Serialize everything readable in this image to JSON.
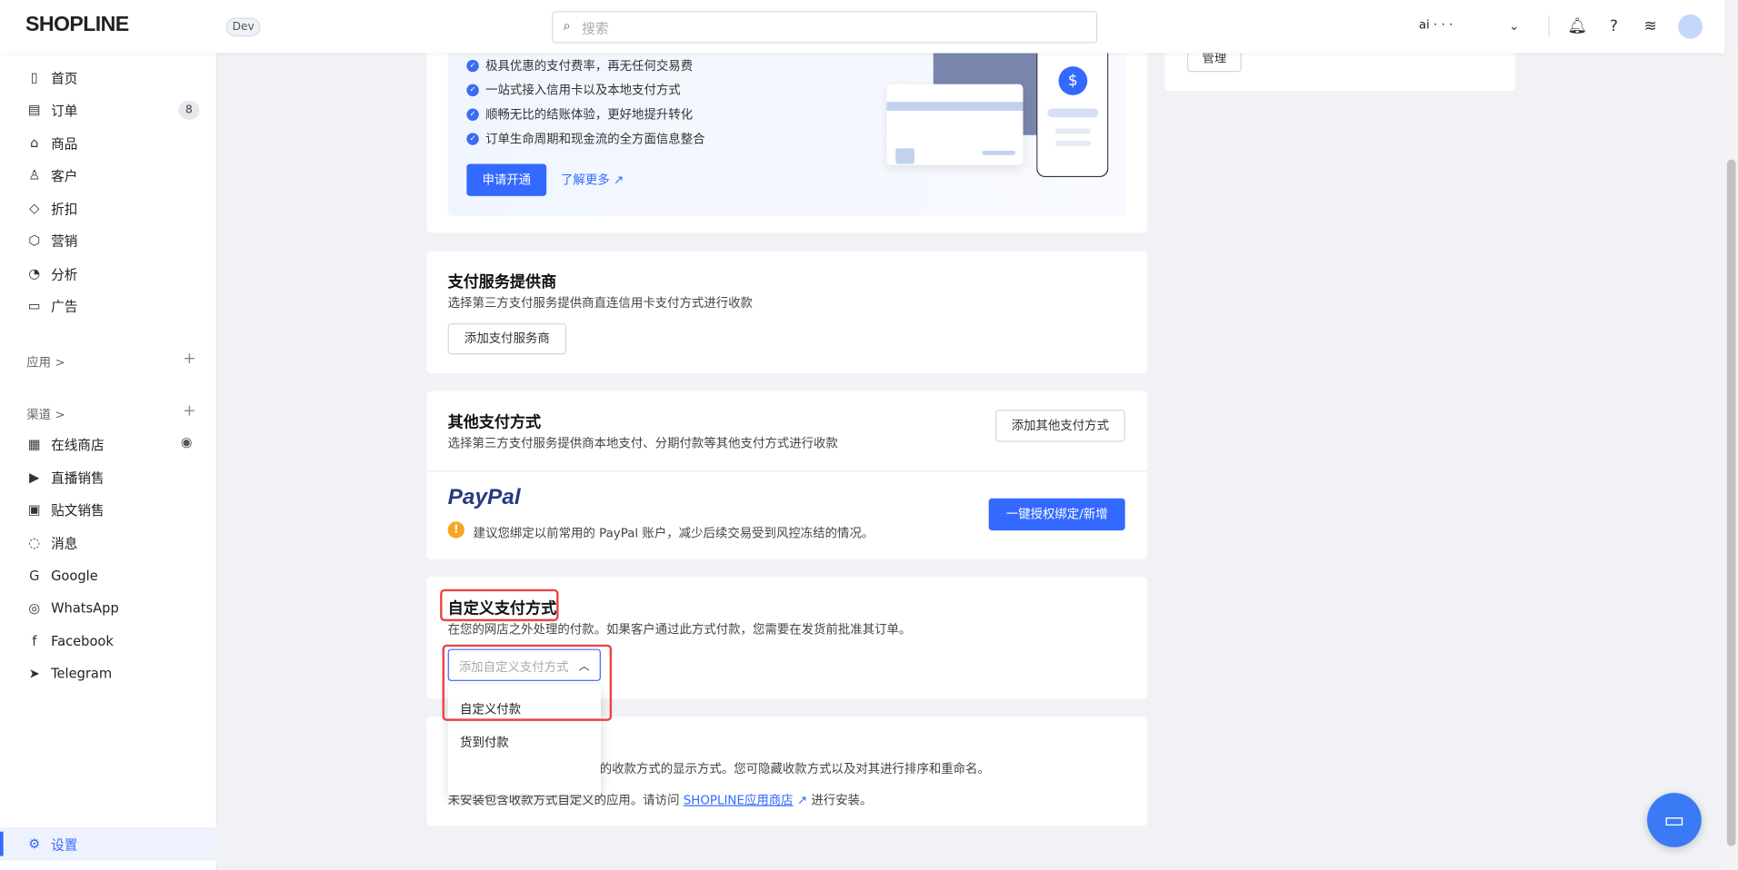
{
  "header": {
    "logo": "SHOPLINE",
    "env_badge": "Dev",
    "search_placeholder": "搜索",
    "account": "ai · · ·"
  },
  "sidebar": {
    "items": [
      {
        "label": "首页",
        "icon": "dashboard-icon"
      },
      {
        "label": "订单",
        "icon": "order-icon",
        "badge": "8"
      },
      {
        "label": "商品",
        "icon": "bag-icon"
      },
      {
        "label": "客户",
        "icon": "user-icon"
      },
      {
        "label": "折扣",
        "icon": "tag-icon"
      },
      {
        "label": "营销",
        "icon": "box-icon"
      },
      {
        "label": "分析",
        "icon": "pie-icon"
      },
      {
        "label": "广告",
        "icon": "ad-icon"
      }
    ],
    "apps_label": "应用 >",
    "channels_label": "渠道 >",
    "channels": [
      {
        "label": "在线商店"
      },
      {
        "label": "直播销售"
      },
      {
        "label": "贴文销售"
      },
      {
        "label": "消息"
      },
      {
        "label": "Google"
      },
      {
        "label": "WhatsApp"
      },
      {
        "label": "Facebook"
      },
      {
        "label": "Telegram"
      }
    ],
    "settings": "设置"
  },
  "promo": {
    "bullets": [
      "极具优惠的支付费率，再无任何交易费",
      "一站式接入信用卡以及本地支付方式",
      "顺畅无比的结账体验，更好地提升转化",
      "订单生命周期和现金流的全方面信息整合"
    ],
    "apply": "申请开通",
    "learn_more": "了解更多"
  },
  "right_card": {
    "manage": "管理"
  },
  "providers": {
    "title": "支付服务提供商",
    "desc": "选择第三方支付服务提供商直连信用卡支付方式进行收款",
    "button": "添加支付服务商"
  },
  "other": {
    "title": "其他支付方式",
    "desc": "选择第三方支付服务提供商本地支付、分期付款等其他支付方式进行收款",
    "button": "添加其他支付方式",
    "paypal_logo": "PayPal",
    "warning": "建议您绑定以前常用的 PayPal 账户，减少后续交易受到风控冻结的情况。",
    "bind_button": "一键授权绑定/新增"
  },
  "custom": {
    "title": "自定义支付方式",
    "desc": "在您的网店之外处理的付款。如果客户通过此方式付款，您需要在发货前批准其订单。",
    "select_placeholder": "添加自定义支付方式",
    "options": [
      "自定义付款",
      "货到付款"
    ]
  },
  "display": {
    "line1": "的收款方式的显示方式。您可隐藏收款方式以及对其进行排序和重命名。",
    "line2_pre": "未安装包含收款方式自定义的应用。请访问",
    "link": "SHOPLINE应用商店",
    "line2_post": "进行安装。"
  },
  "colors": {
    "primary": "#3369ff",
    "highlight": "#e84545"
  }
}
